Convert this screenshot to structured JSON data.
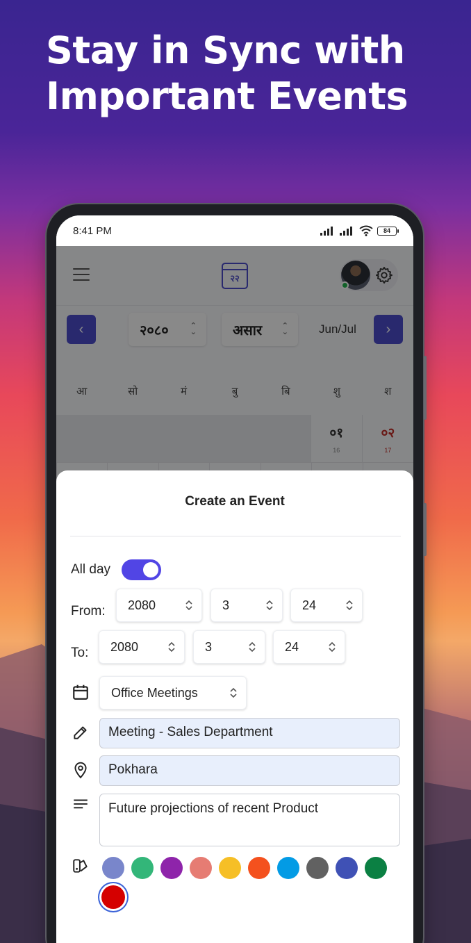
{
  "headline": {
    "line1": "Stay in Sync with",
    "line2": "Important Events"
  },
  "status_bar": {
    "time": "8:41 PM",
    "battery": "84"
  },
  "app": {
    "logo_text": "२२",
    "year": "२०८०",
    "month": "असार",
    "eng_months": "Jun/Jul",
    "weekdays": [
      "आ",
      "सो",
      "मं",
      "बु",
      "बि",
      "शु",
      "श"
    ],
    "days": [
      {
        "np": "०१",
        "en": "16"
      },
      {
        "np": "०२",
        "en": "17"
      }
    ]
  },
  "sheet": {
    "title": "Create an Event",
    "all_day_label": "All day",
    "all_day_on": true,
    "from_label": "From:",
    "to_label": "To:",
    "from": {
      "year": "2080",
      "month": "3",
      "day": "24"
    },
    "to": {
      "year": "2080",
      "month": "3",
      "day": "24"
    },
    "calendar_name": "Office Meetings",
    "event_title": "Meeting - Sales Department",
    "location": "Pokhara",
    "description": "Future projections of recent Product",
    "colors": [
      "#7986cb",
      "#33b679",
      "#8e24aa",
      "#e67c73",
      "#f6bf26",
      "#f4511e",
      "#039be5",
      "#616161",
      "#3f51b5",
      "#0b8043",
      "#d50000"
    ],
    "selected_color": "#d50000"
  }
}
